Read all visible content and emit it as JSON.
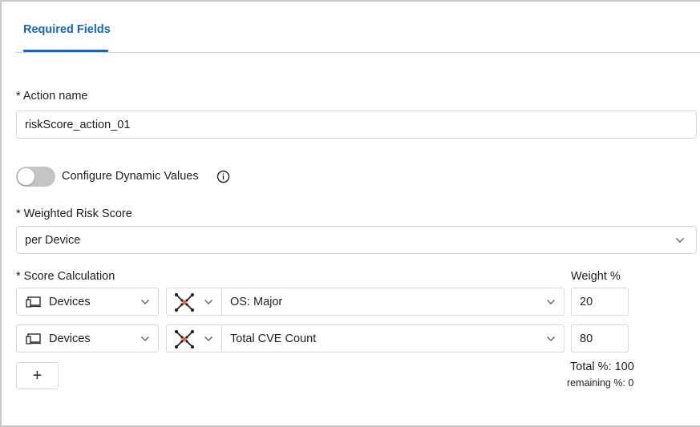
{
  "tabs": [
    {
      "label": "Required Fields",
      "active": true
    }
  ],
  "action_name": {
    "label": "* Action name",
    "value": "riskScore_action_01"
  },
  "dynamic_values": {
    "label": "Configure Dynamic Values",
    "enabled": false,
    "icon": "info-icon"
  },
  "weighted_risk_score": {
    "label": "* Weighted Risk Score",
    "value": "per Device",
    "icon": "chevron-down-icon"
  },
  "score_calculation": {
    "label": "* Score Calculation",
    "weight_label": "Weight %",
    "rows": [
      {
        "entity": "Devices",
        "entity_icon": "devices-icon",
        "operator_icon": "node-network-icon",
        "attribute": "OS: Major",
        "weight": "20"
      },
      {
        "entity": "Devices",
        "entity_icon": "devices-icon",
        "operator_icon": "node-network-icon",
        "attribute": "Total CVE Count",
        "weight": "80"
      }
    ],
    "add_label": "+",
    "total": "Total %: 100",
    "remaining": "remaining %: 0"
  },
  "colors": {
    "accent": "#1565c0",
    "accent_orange": "#e8602c",
    "border": "#d5d8dc",
    "toggle_off": "#c4c4c4"
  }
}
